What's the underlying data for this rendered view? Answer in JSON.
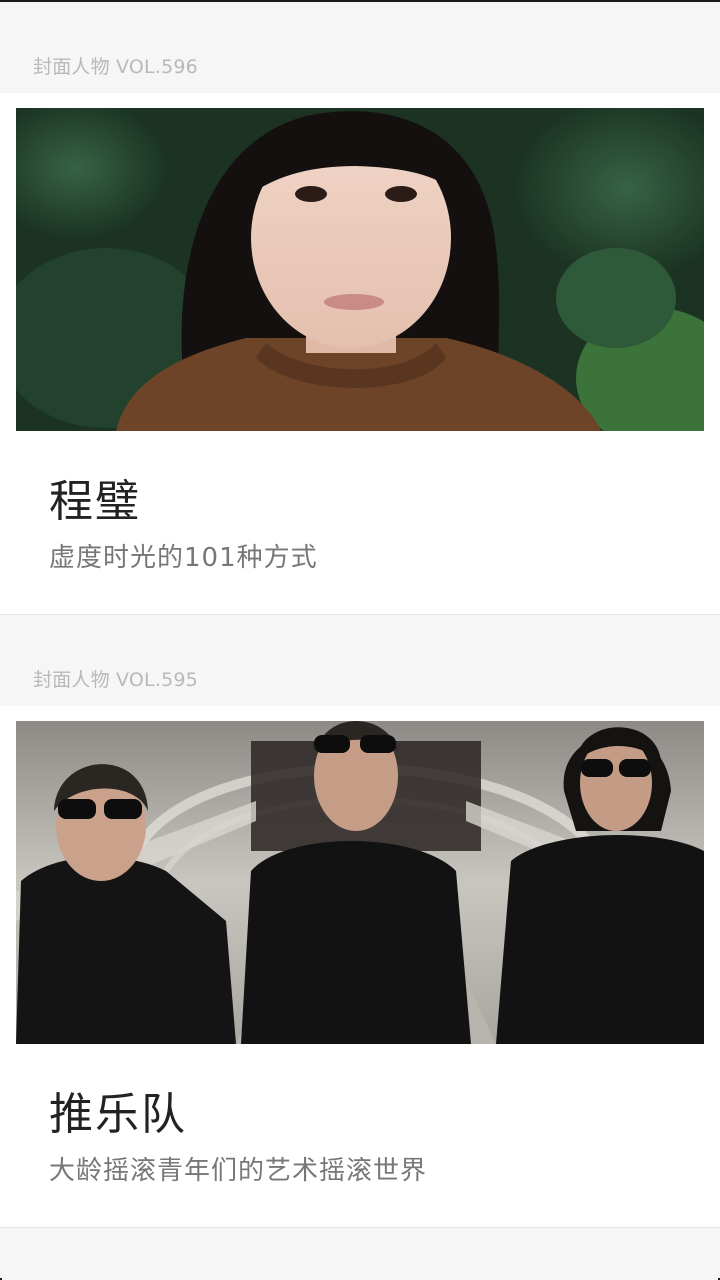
{
  "feed": [
    {
      "label": "封面人物 VOL.596",
      "title": "程璧",
      "subtitle": "虚度时光的101种方式"
    },
    {
      "label": "封面人物 VOL.595",
      "title": "推乐队",
      "subtitle": "大龄摇滚青年们的艺术摇滚世界"
    }
  ]
}
